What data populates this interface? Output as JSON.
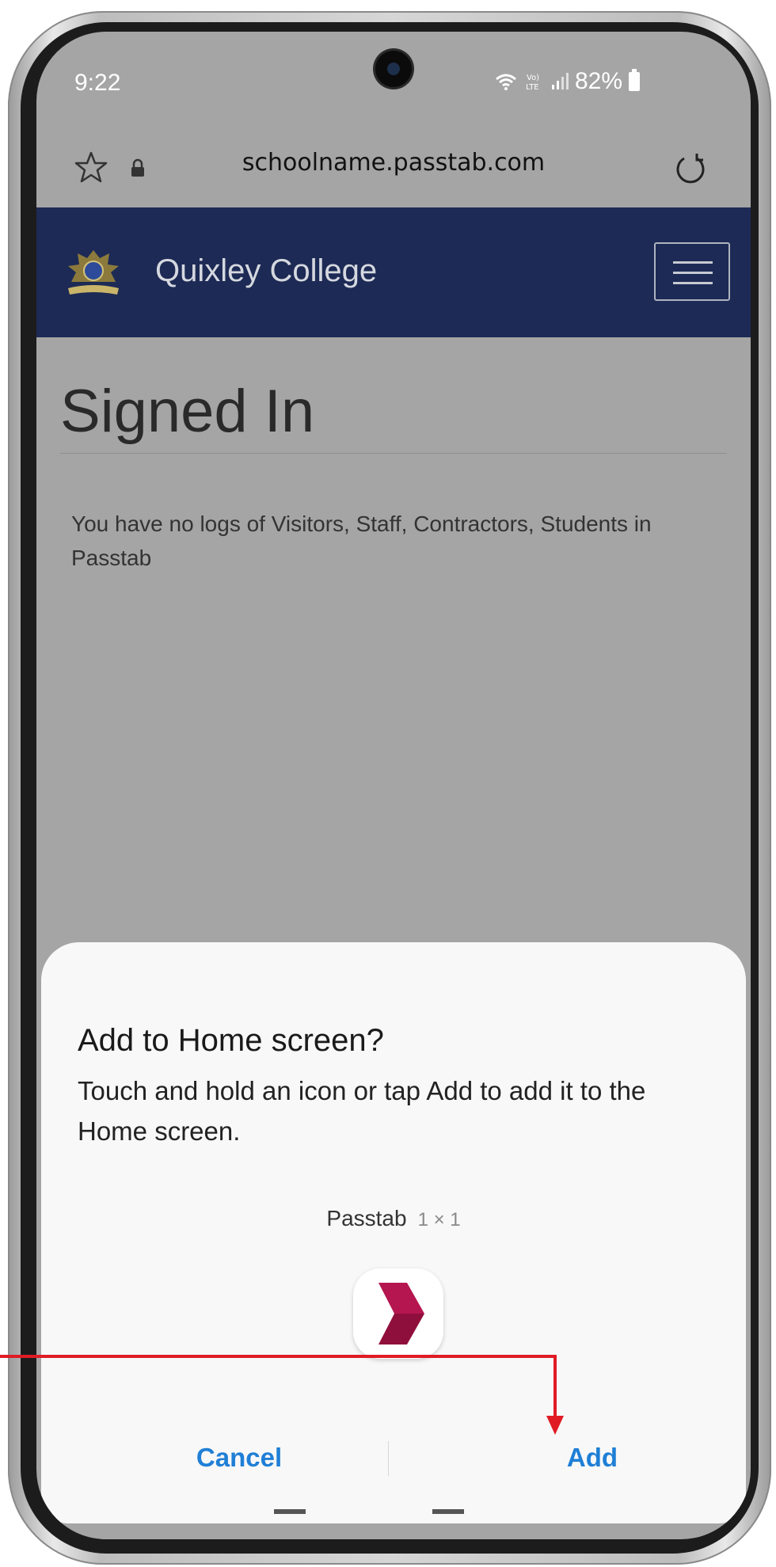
{
  "status_bar": {
    "time": "9:22",
    "battery": "82%",
    "icons": [
      "wifi-icon",
      "volte-lte-icon",
      "signal-icon",
      "battery-icon"
    ]
  },
  "browser": {
    "url": "schoolname.passtab.com",
    "icons": [
      "star-icon",
      "lock-icon",
      "reload-icon"
    ]
  },
  "site_header": {
    "title": "Quixley College",
    "background": "#1d2a55",
    "icons": [
      "crest-icon",
      "hamburger-menu-icon"
    ]
  },
  "page": {
    "title": "Signed In",
    "message": "You have no logs of Visitors, Staff, Contractors, Students in Passtab"
  },
  "dialog": {
    "title": "Add to Home screen?",
    "body": "Touch and hold an icon or tap Add to add it to the Home screen.",
    "app_name": "Passtab",
    "app_size": "1 × 1",
    "app_icon": "passtab-chevron-icon",
    "app_icon_color": "#b5164f",
    "cancel_label": "Cancel",
    "add_label": "Add",
    "button_color": "#1f7fd6"
  },
  "annotation": {
    "arrow_color": "#e01b24",
    "target": "Add"
  }
}
